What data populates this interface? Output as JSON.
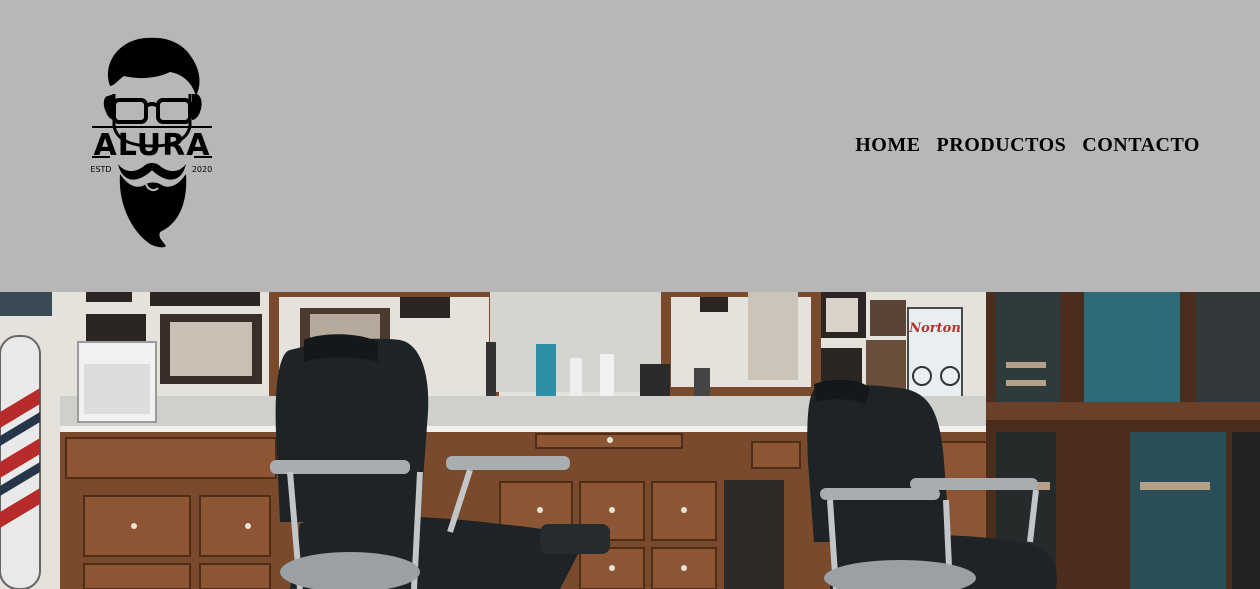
{
  "logo": {
    "brand": "ALURA",
    "estd": "ESTD",
    "year": "2020"
  },
  "nav": {
    "items": [
      "HOME",
      "PRODUCTOS",
      "CONTACTO"
    ]
  },
  "hero": {
    "sign": "Norton"
  },
  "colors": {
    "header_bg": "#b7b7b7",
    "text": "#000000",
    "wood": "#7a4a2c",
    "leather": "#1d2326"
  }
}
